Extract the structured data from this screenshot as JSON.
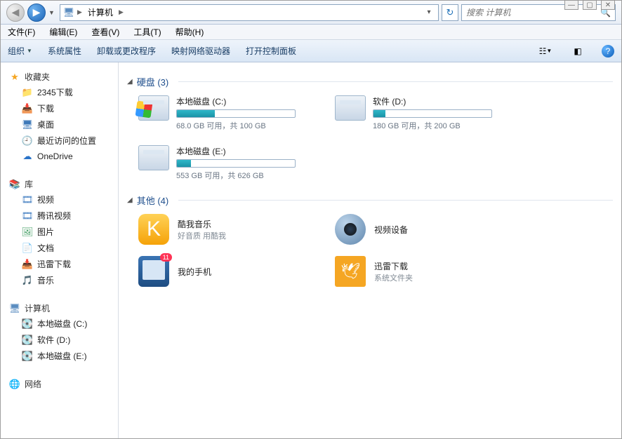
{
  "titlebar": {
    "min": "—",
    "max": "▢",
    "close": "✕"
  },
  "nav": {
    "crumb_root_icon": "🖥",
    "crumb_root": "计算机",
    "search_placeholder": "搜索 计算机"
  },
  "menubar": {
    "file": "文件(F)",
    "edit": "编辑(E)",
    "view": "查看(V)",
    "tools": "工具(T)",
    "help": "帮助(H)"
  },
  "toolbar": {
    "organize": "组织",
    "sysprops": "系统属性",
    "uninstall": "卸载或更改程序",
    "mapdrive": "映射网络驱动器",
    "ctrlpanel": "打开控制面板"
  },
  "sidebar": {
    "favorites": {
      "label": "收藏夹",
      "items": [
        {
          "label": "2345下载"
        },
        {
          "label": "下载"
        },
        {
          "label": "桌面"
        },
        {
          "label": "最近访问的位置"
        },
        {
          "label": "OneDrive"
        }
      ]
    },
    "libraries": {
      "label": "库",
      "items": [
        {
          "label": "视频"
        },
        {
          "label": "腾讯视频"
        },
        {
          "label": "图片"
        },
        {
          "label": "文档"
        },
        {
          "label": "迅雷下载"
        },
        {
          "label": "音乐"
        }
      ]
    },
    "computer": {
      "label": "计算机",
      "items": [
        {
          "label": "本地磁盘 (C:)"
        },
        {
          "label": "软件 (D:)"
        },
        {
          "label": "本地磁盘 (E:)"
        }
      ]
    },
    "network": {
      "label": "网络"
    }
  },
  "content": {
    "hdd": {
      "heading": "硬盘 (3)",
      "drives": [
        {
          "name": "本地磁盘 (C:)",
          "free": "68.0 GB 可用，共 100 GB",
          "pct": 32,
          "win": true
        },
        {
          "name": "软件 (D:)",
          "free": "180 GB 可用，共 200 GB",
          "pct": 10,
          "win": false
        },
        {
          "name": "本地磁盘 (E:)",
          "free": "553 GB 可用，共 626 GB",
          "pct": 12,
          "win": false
        }
      ]
    },
    "other": {
      "heading": "其他 (4)",
      "items": [
        {
          "name": "酷我音乐",
          "sub": "好音质 用酷我"
        },
        {
          "name": "视频设备",
          "sub": ""
        },
        {
          "name": "我的手机",
          "sub": ""
        },
        {
          "name": "迅雷下载",
          "sub": "系统文件夹"
        }
      ]
    }
  }
}
